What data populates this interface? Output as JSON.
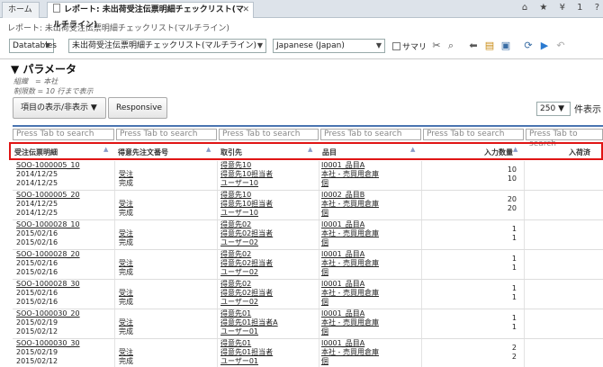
{
  "tabs": {
    "home": "ホーム",
    "report": "レポート: 未出荷受注伝票明細チェックリスト(マルチライン)"
  },
  "topbar_icons": [
    "house-icon",
    "star-icon",
    "chevron-down-icon",
    "number-1",
    "help-icon"
  ],
  "subtitle": "レポート: 未出荷受注伝票明細チェックリスト(マルチライン)",
  "toolbar": {
    "datasource": "Datatables",
    "report": "未出荷受注伝票明細チェックリスト(マルチライン)",
    "language": "Japanese (Japan)",
    "summary_label": "サマリ"
  },
  "toolbar_icons": [
    "scissors-icon",
    "magnifier-icon",
    "arrow-left-icon",
    "list-icon",
    "save-icon",
    "print-icon",
    "refresh-icon",
    "play-icon",
    "undo-icon"
  ],
  "params": {
    "title": "▼ パラメータ",
    "line1": "組織　= 本社",
    "line2": "制限数 = 10 行まで表示"
  },
  "buttons": {
    "columns": "項目の表示/非表示",
    "responsive": "Responsive"
  },
  "page_size": {
    "value": "250",
    "label": "件表示"
  },
  "filter_placeholder": "Press Tab to search",
  "columns": [
    "受注伝票明細",
    "得意先注文番号",
    "取引先",
    "品目",
    "入力数量",
    "入荷済"
  ],
  "rows": [
    {
      "id": "SOO-1000005_10",
      "d1": "2014/12/25",
      "d2": "2014/12/25",
      "ref1": "受注",
      "ref2": "完成",
      "bp1": "得意先10",
      "bp2": "得意先10担当者",
      "bp3": "ユーザー10",
      "it1": "I0001_品目A",
      "it2": "本社 - 売買用倉庫",
      "it3": "個",
      "q1": "10",
      "q2": "10"
    },
    {
      "id": "SOO-1000005_20",
      "d1": "2014/12/25",
      "d2": "2014/12/25",
      "ref1": "受注",
      "ref2": "完成",
      "bp1": "得意先10",
      "bp2": "得意先10担当者",
      "bp3": "ユーザー10",
      "it1": "I0002_品目B",
      "it2": "本社 - 売買用倉庫",
      "it3": "個",
      "q1": "20",
      "q2": "20"
    },
    {
      "id": "SOO-1000028_10",
      "d1": "2015/02/16",
      "d2": "2015/02/16",
      "ref1": "受注",
      "ref2": "完成",
      "bp1": "得意先02",
      "bp2": "得意先02担当者",
      "bp3": "ユーザー02",
      "it1": "I0001_品目A",
      "it2": "本社 - 売買用倉庫",
      "it3": "個",
      "q1": "1",
      "q2": "1"
    },
    {
      "id": "SOO-1000028_20",
      "d1": "2015/02/16",
      "d2": "2015/02/16",
      "ref1": "受注",
      "ref2": "完成",
      "bp1": "得意先02",
      "bp2": "得意先02担当者",
      "bp3": "ユーザー02",
      "it1": "I0001_品目A",
      "it2": "本社 - 売買用倉庫",
      "it3": "個",
      "q1": "1",
      "q2": "1"
    },
    {
      "id": "SOO-1000028_30",
      "d1": "2015/02/16",
      "d2": "2015/02/16",
      "ref1": "受注",
      "ref2": "完成",
      "bp1": "得意先02",
      "bp2": "得意先02担当者",
      "bp3": "ユーザー02",
      "it1": "I0001_品目A",
      "it2": "本社 - 売買用倉庫",
      "it3": "個",
      "q1": "1",
      "q2": "1"
    },
    {
      "id": "SOO-1000030_20",
      "d1": "2015/02/19",
      "d2": "2015/02/12",
      "ref1": "受注",
      "ref2": "完成",
      "bp1": "得意先01",
      "bp2": "得意先01担当者A",
      "bp3": "ユーザー01",
      "it1": "I0001_品目A",
      "it2": "本社 - 売買用倉庫",
      "it3": "個",
      "q1": "1",
      "q2": "1"
    },
    {
      "id": "SOO-1000030_30",
      "d1": "2015/02/19",
      "d2": "2015/02/12",
      "ref1": "受注",
      "ref2": "完成",
      "bp1": "得意先01",
      "bp2": "得意先01担当者",
      "bp3": "ユーザー01",
      "it1": "I0001_品目A",
      "it2": "本社 - 売買用倉庫",
      "it3": "個",
      "q1": "2",
      "q2": "2"
    }
  ],
  "colors": {
    "highlight": "#e01515",
    "tab_bg": "#dde3ea",
    "accent": "#4a74b0"
  }
}
